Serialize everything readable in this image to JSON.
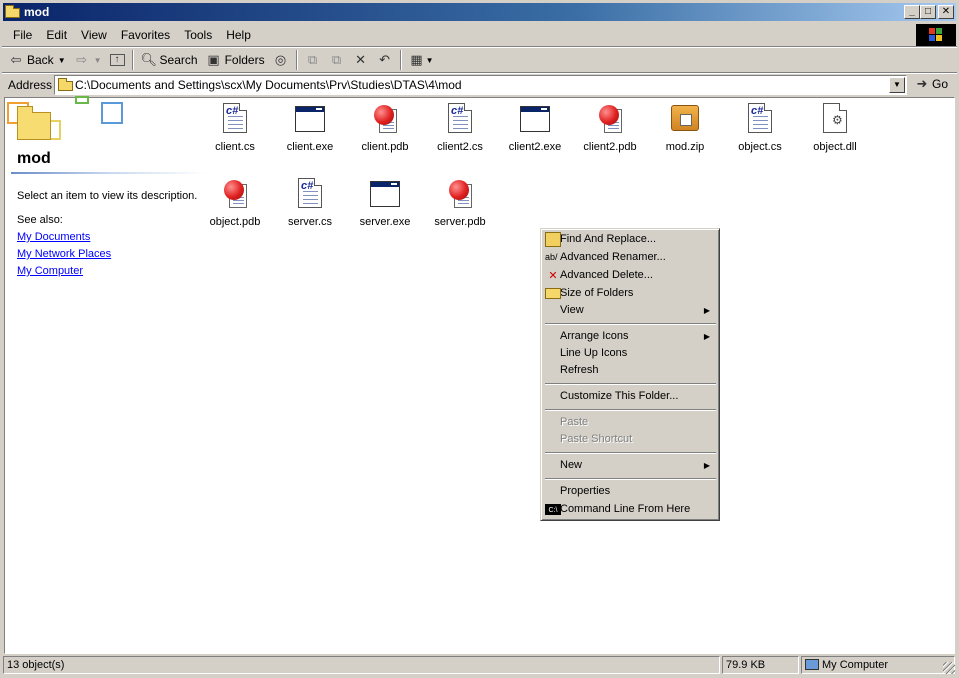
{
  "window": {
    "title": "mod",
    "buttons": [
      "minimize",
      "maximize",
      "close"
    ]
  },
  "menubar": {
    "items": [
      "File",
      "Edit",
      "View",
      "Favorites",
      "Tools",
      "Help"
    ]
  },
  "toolbar": {
    "back_label": "Back",
    "search_label": "Search",
    "folders_label": "Folders"
  },
  "address": {
    "label": "Address",
    "value": "C:\\Documents and Settings\\scx\\My Documents\\Prv\\Studies\\DTAS\\4\\mod",
    "go_label": "Go"
  },
  "leftpane": {
    "folder_name": "mod",
    "description": "Select an item to view its description.",
    "see_also_label": "See also:",
    "links": [
      "My Documents",
      "My Network Places",
      "My Computer"
    ]
  },
  "files": [
    {
      "name": "client.cs",
      "icon": "csharp-file-icon"
    },
    {
      "name": "client.exe",
      "icon": "exe-file-icon"
    },
    {
      "name": "client.pdb",
      "icon": "pdb-file-icon"
    },
    {
      "name": "client2.cs",
      "icon": "csharp-file-icon"
    },
    {
      "name": "client2.exe",
      "icon": "exe-file-icon"
    },
    {
      "name": "client2.pdb",
      "icon": "pdb-file-icon"
    },
    {
      "name": "mod.zip",
      "icon": "zip-file-icon"
    },
    {
      "name": "object.cs",
      "icon": "csharp-file-icon"
    },
    {
      "name": "object.dll",
      "icon": "dll-file-icon"
    },
    {
      "name": "object.pdb",
      "icon": "pdb-file-icon"
    },
    {
      "name": "server.cs",
      "icon": "csharp-file-icon"
    },
    {
      "name": "server.exe",
      "icon": "exe-file-icon"
    },
    {
      "name": "server.pdb",
      "icon": "pdb-file-icon"
    }
  ],
  "context_menu": {
    "find_replace": "Find And Replace...",
    "adv_renamer": "Advanced Renamer...",
    "adv_delete": "Advanced Delete...",
    "size_folders": "Size of Folders",
    "view": "View",
    "arrange_icons": "Arrange Icons",
    "line_up_icons": "Line Up Icons",
    "refresh": "Refresh",
    "customize": "Customize This Folder...",
    "paste": "Paste",
    "paste_shortcut": "Paste Shortcut",
    "new": "New",
    "properties": "Properties",
    "command_line": "Command Line From Here"
  },
  "statusbar": {
    "object_count": "13 object(s)",
    "size": "79.9 KB",
    "zone": "My Computer"
  },
  "colors": {
    "titlebar_start": "#0a246a",
    "titlebar_end": "#a6caf0",
    "face": "#d4d0c8",
    "link": "#0000ff"
  }
}
